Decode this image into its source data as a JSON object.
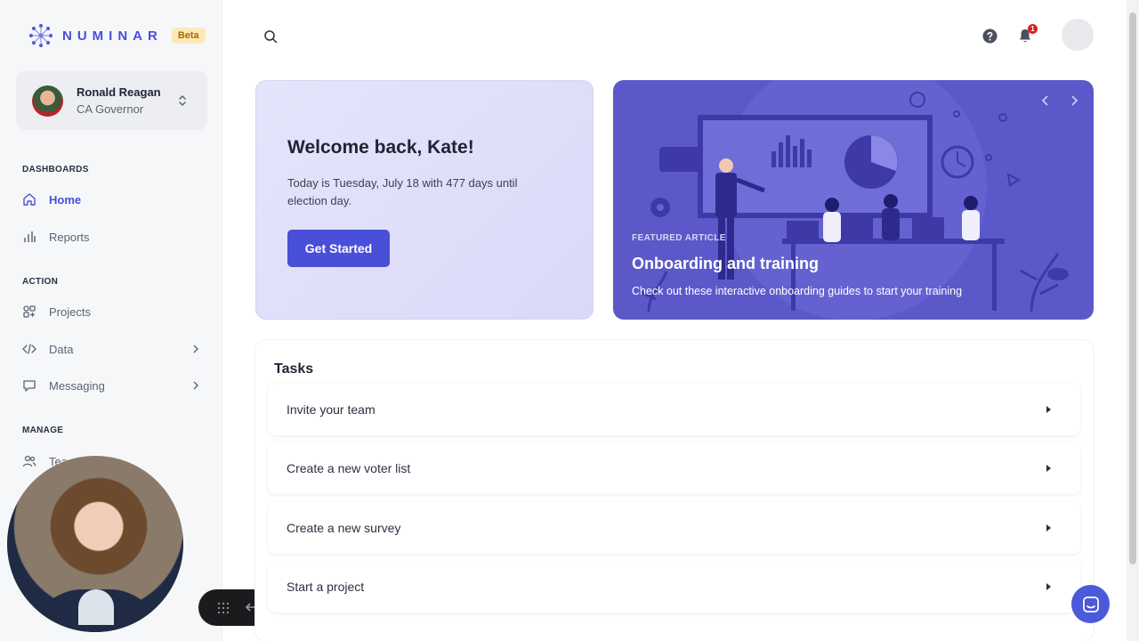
{
  "brand": {
    "name": "NUMINAR",
    "badge": "Beta"
  },
  "account": {
    "name": "Ronald Reagan",
    "role": "CA Governor"
  },
  "sidebar": {
    "sections": {
      "dashboards": "DASHBOARDS",
      "action": "ACTION",
      "manage": "MANAGE"
    },
    "items": [
      {
        "label": "Home",
        "icon": "home-icon"
      },
      {
        "label": "Reports",
        "icon": "chart-icon"
      },
      {
        "label": "Projects",
        "icon": "grid-icon"
      },
      {
        "label": "Data",
        "icon": "code-icon"
      },
      {
        "label": "Messaging",
        "icon": "message-icon"
      },
      {
        "label": "Tea",
        "icon": "team-icon"
      }
    ]
  },
  "header": {
    "notification_count": "1"
  },
  "welcome": {
    "title": "Welcome back, Kate!",
    "text": "Today is Tuesday, July 18 with 477 days until election day.",
    "button": "Get Started"
  },
  "featured": {
    "label": "FEATURED ARTICLE",
    "title": "Onboarding and training",
    "subtitle": "Check out these interactive onboarding guides to start your training"
  },
  "tasks": {
    "title": "Tasks",
    "items": [
      "Invite your team",
      "Create a new voter list",
      "Create a new survey",
      "Start a project"
    ]
  },
  "colors": {
    "accent": "#4a4fd8",
    "featured_bg": "#5b59c9",
    "badge": "#d92020"
  }
}
